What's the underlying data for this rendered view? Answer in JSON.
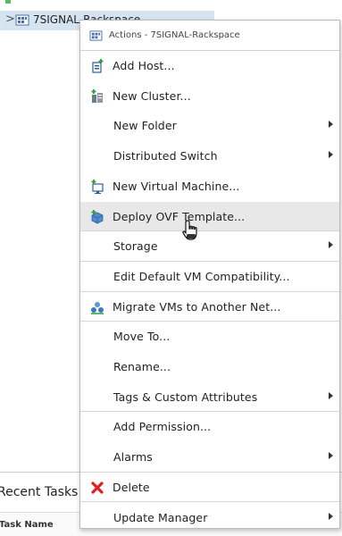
{
  "tree": {
    "chevron": ">",
    "datacenter_label": "7SIGNAL-Rackspace"
  },
  "menu": {
    "header": "Actions - 7SIGNAL-Rackspace",
    "items": [
      {
        "label": "Add Host...",
        "icon": "add-host-icon",
        "submenu": false
      },
      {
        "label": "New Cluster...",
        "icon": "new-cluster-icon",
        "submenu": false
      },
      {
        "label": "New Folder",
        "icon": "",
        "submenu": true
      },
      {
        "label": "Distributed Switch",
        "icon": "",
        "submenu": true
      },
      {
        "label": "New Virtual Machine...",
        "icon": "new-vm-icon",
        "submenu": false
      },
      {
        "label": "Deploy OVF Template...",
        "icon": "deploy-ovf-icon",
        "submenu": false
      },
      {
        "label": "Storage",
        "icon": "",
        "submenu": true
      },
      {
        "label": "Edit Default VM Compatibility...",
        "icon": "",
        "submenu": false
      },
      {
        "label": "Migrate VMs to Another Net...",
        "icon": "migrate-network-icon",
        "submenu": false
      },
      {
        "label": "Move To...",
        "icon": "",
        "submenu": false
      },
      {
        "label": "Rename...",
        "icon": "",
        "submenu": false
      },
      {
        "label": "Tags & Custom Attributes",
        "icon": "",
        "submenu": true
      },
      {
        "label": "Add Permission...",
        "icon": "",
        "submenu": false
      },
      {
        "label": "Alarms",
        "icon": "",
        "submenu": true
      },
      {
        "label": "Delete",
        "icon": "delete-x-icon",
        "submenu": false
      },
      {
        "label": "Update Manager",
        "icon": "",
        "submenu": true
      }
    ],
    "hovered_item": "Deploy OVF Template..."
  },
  "tasks": {
    "title": "Recent Tasks",
    "column_task_name": "Task Name"
  },
  "colors": {
    "selected_row": "#d6e4f2",
    "menu_hover": "#e8e8e8",
    "delete_red": "#e02020"
  }
}
